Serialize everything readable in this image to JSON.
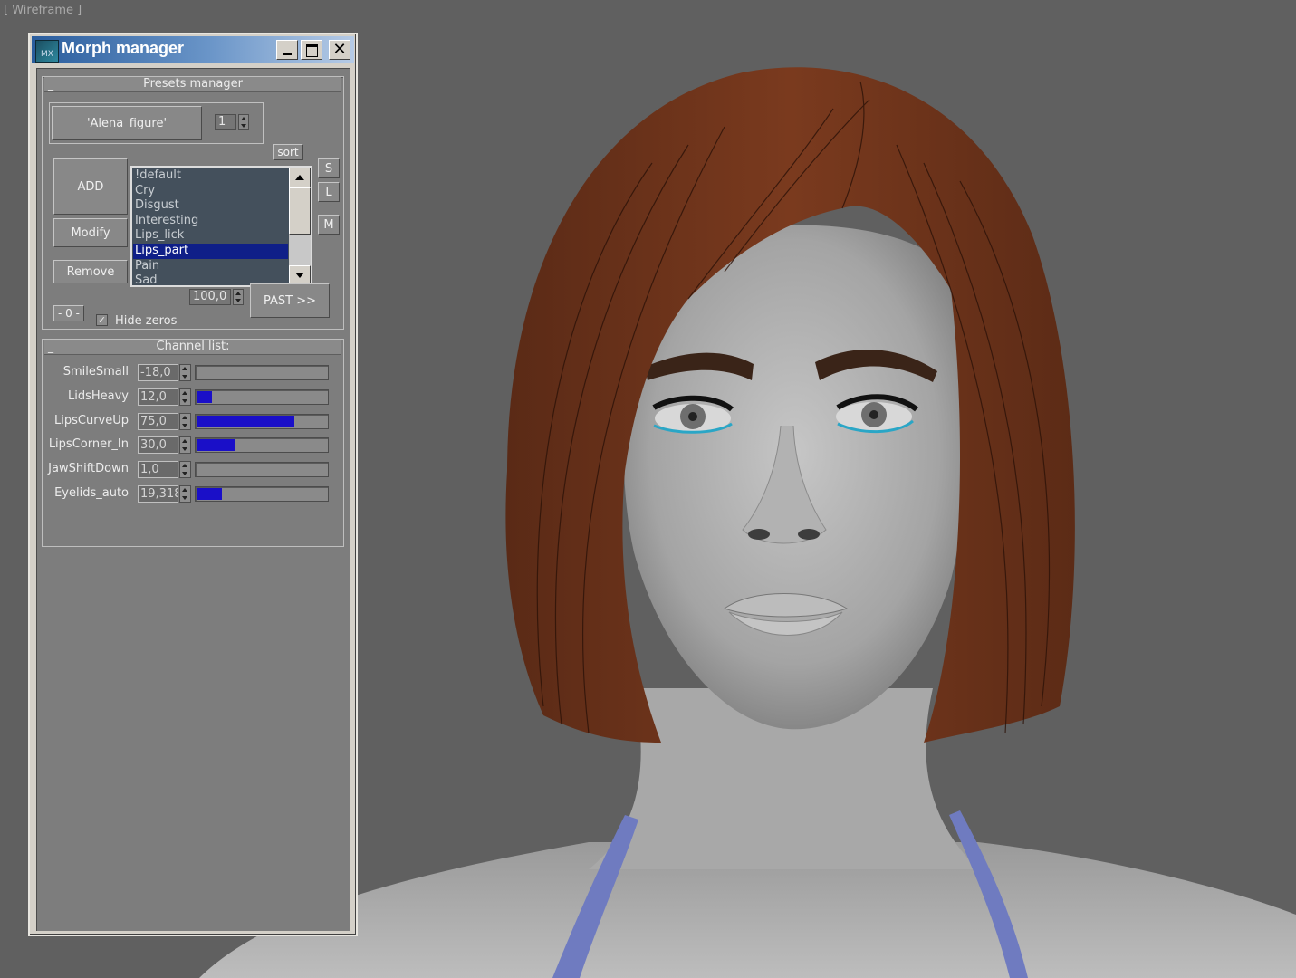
{
  "viewport": {
    "label": "[ Wireframe ]"
  },
  "window": {
    "title": "Morph manager",
    "icon_label": "MX",
    "icon": "app-logo-icon"
  },
  "presets": {
    "header": "Presets manager",
    "collapse_label": "_",
    "preset_name": "'Alena_figure'",
    "preset_index": "1",
    "sort_label": "sort",
    "add_label": "ADD",
    "modify_label": "Modify",
    "remove_label": "Remove",
    "s_label": "S",
    "l_label": "L",
    "m_label": "M",
    "items": [
      "!default",
      "Cry",
      "Disgust",
      "Interesting",
      "Lips_lick",
      "Lips_part",
      "Pain",
      "Sad"
    ],
    "selected_item": "Lips_part",
    "zero_label": "- 0 -",
    "hide_zeros_label": "Hide zeros",
    "hide_zeros_checked": true,
    "percent_value": "100,0",
    "paste_label": "PAST >>"
  },
  "channels": {
    "header": "Channel list:",
    "collapse_label": "_",
    "fill_color": "#1a0fc8",
    "rows": [
      {
        "label": "SmileSmall",
        "value": "-18,0",
        "fill": 0.0
      },
      {
        "label": "LidsHeavy",
        "value": "12,0",
        "fill": 0.12
      },
      {
        "label": "LipsCurveUp",
        "value": "75,0",
        "fill": 0.75
      },
      {
        "label": "LipsCorner_In",
        "value": "30,0",
        "fill": 0.3
      },
      {
        "label": "JawShiftDown",
        "value": "1,0",
        "fill": 0.01
      },
      {
        "label": "Eyelids_auto",
        "value": "19,318",
        "fill": 0.193
      }
    ]
  }
}
